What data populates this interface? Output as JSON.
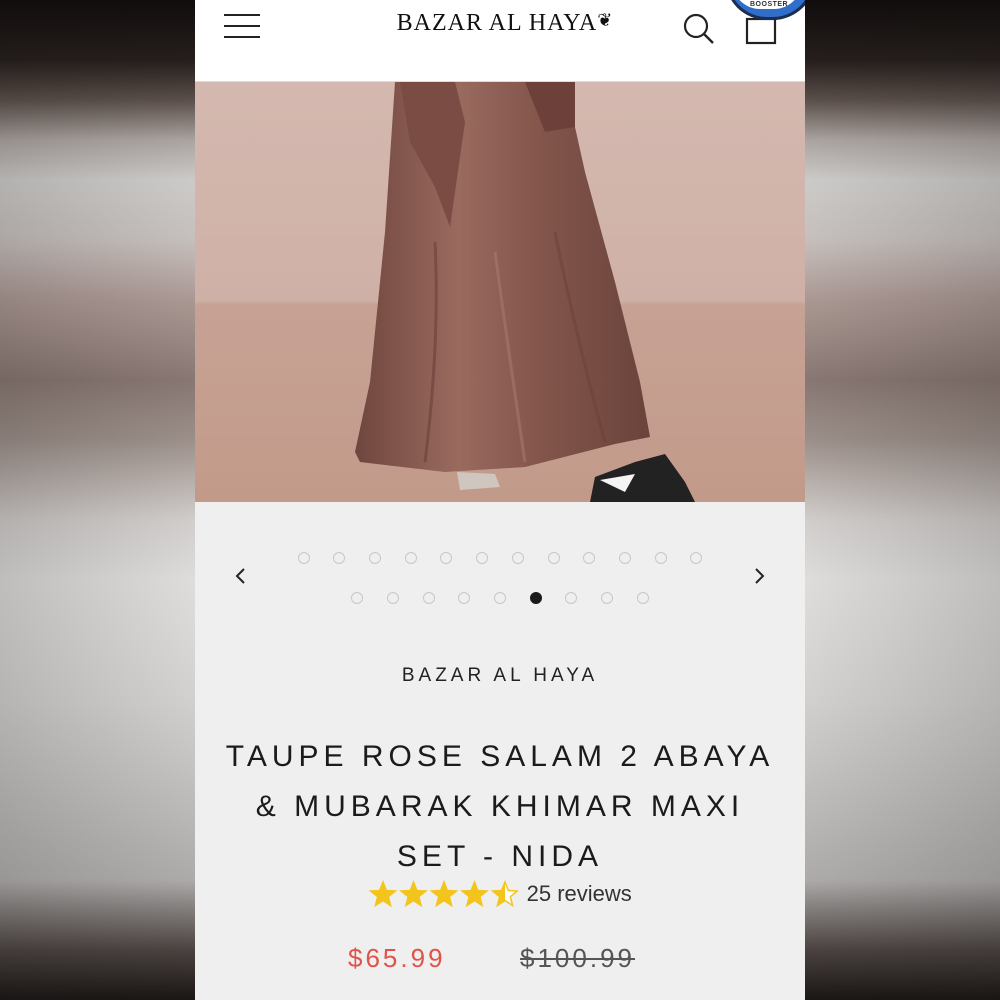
{
  "header": {
    "logo_text": "BAZAR AL HAYA",
    "badge_text": "BOOSTER"
  },
  "gallery": {
    "total_images": 21,
    "active_index": 17
  },
  "product": {
    "vendor": "BAZAR AL HAYA",
    "title": "TAUPE ROSE SALAM 2 ABAYA & MUBARAK KHIMAR MAXI SET - NIDA",
    "rating": 4.5,
    "reviews_label": "25 reviews",
    "price": "$65.99",
    "compare_price": "$100.99"
  },
  "colors": {
    "sale_price": "#e0534a",
    "star": "#f3c41b",
    "fabric": "#8c5f55"
  }
}
